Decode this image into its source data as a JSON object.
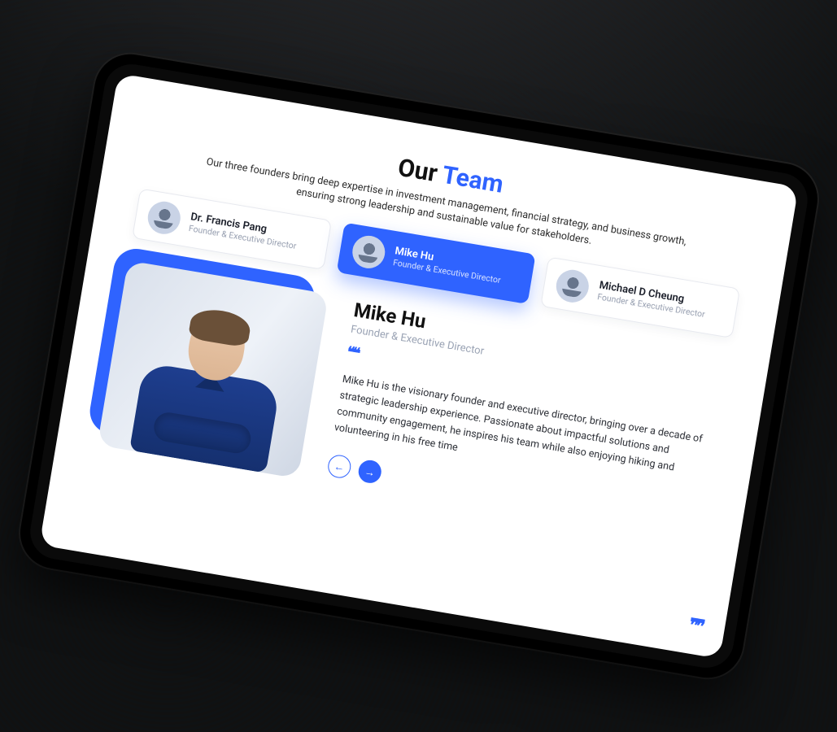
{
  "heading": {
    "pre": "Our ",
    "accent": "Team"
  },
  "sub": "Our three founders bring deep expertise in investment management, financial strategy, and business growth, ensuring strong leadership and sustainable value for stakeholders.",
  "members": [
    {
      "name": "Dr. Francis Pang",
      "role": "Founder & Executive Director"
    },
    {
      "name": "Mike Hu",
      "role": "Founder & Executive Director"
    },
    {
      "name": "Michael D Cheung",
      "role": "Founder & Executive Director"
    }
  ],
  "selected": {
    "name": "Mike Hu",
    "role": "Founder & Executive Director",
    "bio": "Mike Hu is the visionary founder and executive director, bringing over a decade of strategic leadership experience. Passionate about impactful solutions and community engagement, he inspires his team while also enjoying hiking and volunteering in his free time"
  },
  "icons": {
    "quote_open": "❝❝",
    "quote_close": "❞❞",
    "arrow_left": "←",
    "arrow_right": "→"
  },
  "colors": {
    "accent": "#2f63ff"
  }
}
